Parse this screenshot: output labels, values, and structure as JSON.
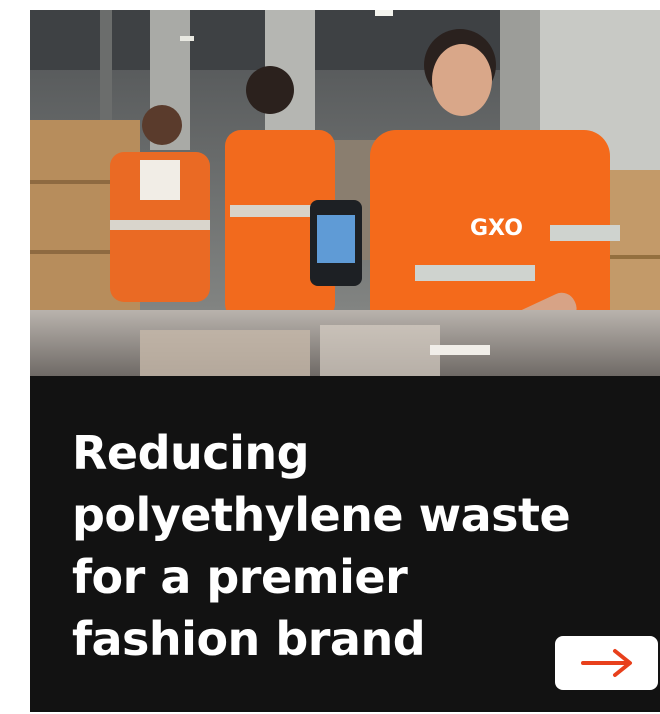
{
  "card": {
    "headline": "Reducing polyethylene waste for a premier fashion brand",
    "cta_icon": "arrow-right-icon",
    "accent_color": "#e8401c"
  },
  "hero": {
    "shirt_text": "GXO"
  }
}
